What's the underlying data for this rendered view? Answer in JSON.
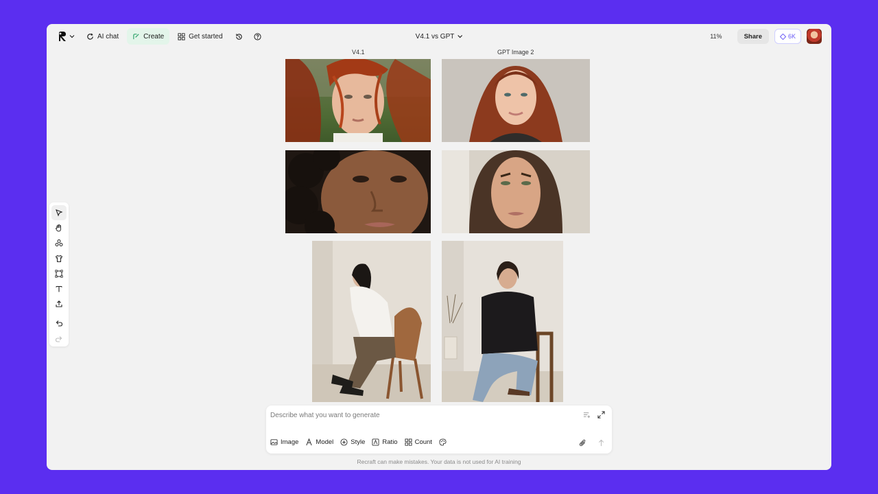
{
  "topbar": {
    "ai_chat": "AI chat",
    "create": "Create",
    "get_started": "Get started",
    "project_title": "V4.1 vs GPT",
    "zoom": "11%",
    "share": "Share",
    "credits": "6K"
  },
  "canvas": {
    "col1_label": "V4.1",
    "col2_label": "GPT Image 2"
  },
  "prompt": {
    "placeholder": "Describe what you want to generate",
    "options": [
      "Image",
      "Model",
      "Style",
      "Ratio",
      "Count"
    ]
  },
  "disclaimer": "Recraft can make mistakes. Your data is not used for AI training",
  "colors": {
    "accent": "#5b2ef0",
    "create_bg": "#e3f5ea",
    "credits": "#6b5cf5"
  }
}
